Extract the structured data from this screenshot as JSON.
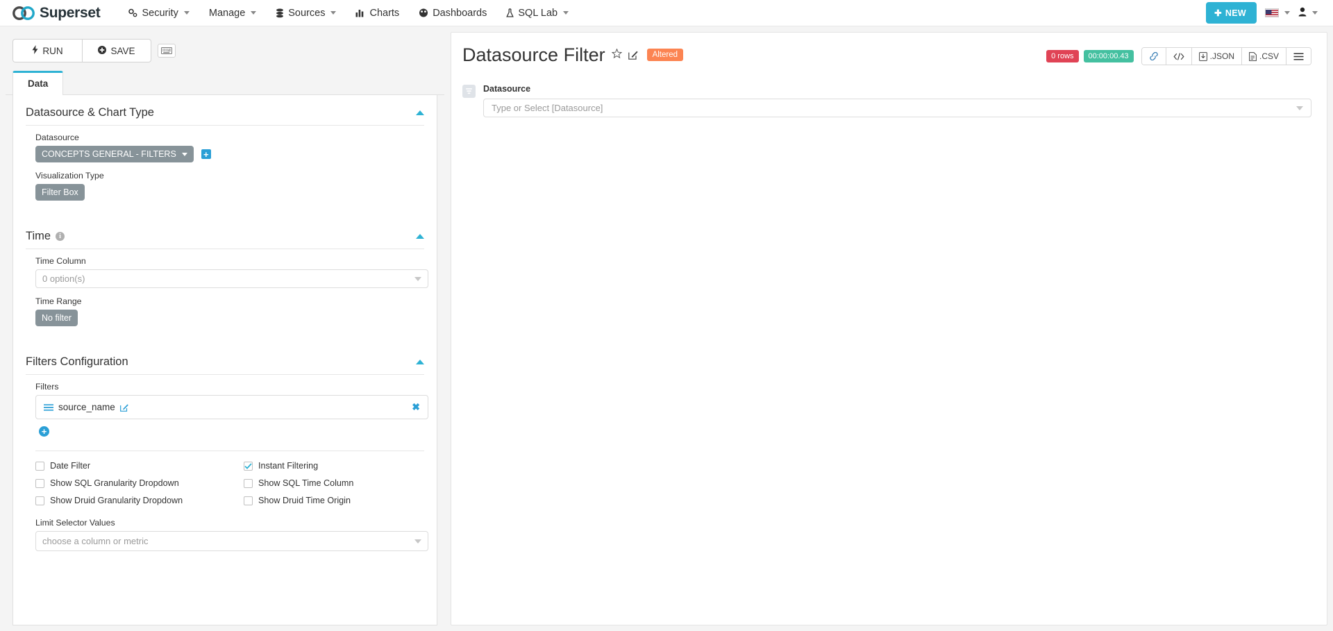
{
  "navbar": {
    "brand": "Superset",
    "items": [
      {
        "label": "Security",
        "icon": "gears-icon",
        "caret": true
      },
      {
        "label": "Manage",
        "icon": "",
        "caret": true
      },
      {
        "label": "Sources",
        "icon": "database-icon",
        "caret": true
      },
      {
        "label": "Charts",
        "icon": "bar-chart-icon",
        "caret": false
      },
      {
        "label": "Dashboards",
        "icon": "dashboard-icon",
        "caret": false
      },
      {
        "label": "SQL Lab",
        "icon": "flask-icon",
        "caret": true
      }
    ],
    "new_button": "NEW",
    "language_icon": "us-flag-icon",
    "user_icon": "user-icon",
    "accent": "#2eb2d4"
  },
  "left_panel": {
    "run_label": "RUN",
    "save_label": "SAVE",
    "keyboard_icon": "keyboard-icon",
    "tab_label": "Data",
    "sections": {
      "datasource_chart_type": {
        "title": "Datasource & Chart Type",
        "datasource_label": "Datasource",
        "datasource_value": "CONCEPTS GENERAL - FILTERS",
        "viz_type_label": "Visualization Type",
        "viz_type_value": "Filter Box"
      },
      "time": {
        "title": "Time",
        "time_column_label": "Time Column",
        "time_column_value": "0 option(s)",
        "time_range_label": "Time Range",
        "time_range_value": "No filter"
      },
      "filters_configuration": {
        "title": "Filters Configuration",
        "filters_label": "Filters",
        "filters": [
          {
            "name": "source_name"
          }
        ],
        "checkboxes": [
          {
            "label": "Date Filter",
            "checked": false
          },
          {
            "label": "Instant Filtering",
            "checked": true
          },
          {
            "label": "Show SQL Granularity Dropdown",
            "checked": false
          },
          {
            "label": "Show SQL Time Column",
            "checked": false
          },
          {
            "label": "Show Druid Granularity Dropdown",
            "checked": false
          },
          {
            "label": "Show Druid Time Origin",
            "checked": false
          }
        ],
        "limit_selector_label": "Limit Selector Values",
        "limit_selector_placeholder": "choose a column or metric"
      }
    }
  },
  "chart": {
    "title": "Datasource Filter",
    "star_icon": "star-outline-icon",
    "edit_icon": "pencil-edit-icon",
    "status_badge": "Altered",
    "rows_badge": "0 rows",
    "timer_badge": "00:00:00.43",
    "toolbar": [
      {
        "name": "link-icon",
        "label": ""
      },
      {
        "name": "code-icon",
        "label": ""
      },
      {
        "name": "json-download-icon",
        "label": ".JSON"
      },
      {
        "name": "csv-download-icon",
        "label": ".CSV"
      },
      {
        "name": "hamburger-menu-icon",
        "label": ""
      }
    ],
    "filterbox": {
      "icon": "filter-box-icon",
      "label": "Datasource",
      "placeholder": "Type or Select [Datasource]"
    },
    "colors": {
      "altered": "#fc8452",
      "rows": "#e04355",
      "timer": "#44c0a0"
    }
  }
}
